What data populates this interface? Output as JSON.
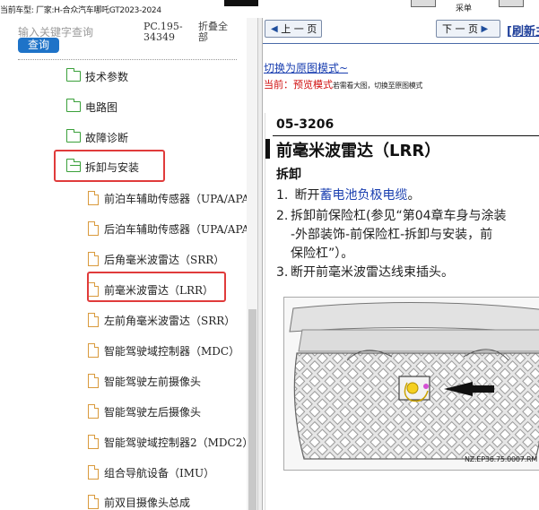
{
  "topbar": {
    "vehicle_info": "当前车型:   厂家:H-合众汽车哪吒GT2023-2024",
    "tool_left_label": "",
    "tool_right_label": "采单"
  },
  "sidebar": {
    "search_placeholder": "输入关键字查询",
    "search_button": "查询",
    "model_code": "PC.195-34349",
    "collapse_all": "折叠全部",
    "tree": [
      {
        "label": "技术参数",
        "kind": "folder",
        "open": false
      },
      {
        "label": "电路图",
        "kind": "folder",
        "open": false
      },
      {
        "label": "故障诊断",
        "kind": "folder",
        "open": false
      },
      {
        "label": "拆卸与安装",
        "kind": "folder",
        "open": true,
        "highlighted": true
      },
      {
        "label": "前泊车辅助传感器（UPA/APA）",
        "kind": "doc"
      },
      {
        "label": "后泊车辅助传感器（UPA/APA）",
        "kind": "doc"
      },
      {
        "label": "后角毫米波雷达（SRR）",
        "kind": "doc"
      },
      {
        "label": "前毫米波雷达（LRR）",
        "kind": "doc",
        "highlighted": true
      },
      {
        "label": "左前角毫米波雷达（SRR）",
        "kind": "doc"
      },
      {
        "label": "智能驾驶域控制器（MDC）",
        "kind": "doc"
      },
      {
        "label": "智能驾驶左前摄像头",
        "kind": "doc"
      },
      {
        "label": "智能驾驶左后摄像头",
        "kind": "doc"
      },
      {
        "label": "智能驾驶域控制器2（MDC2）",
        "kind": "doc"
      },
      {
        "label": "组合导航设备（IMU）",
        "kind": "doc"
      },
      {
        "label": "前双目摄像头总成",
        "kind": "doc"
      }
    ]
  },
  "viewer": {
    "prev_page": "上 一 页",
    "next_page": "下 一 页",
    "refresh": "[刷新主",
    "switch_mode": "切换为原图模式~",
    "current_label": "当前：",
    "current_mode": "预览模式",
    "current_hint": "若需看大图，切换至原图模式"
  },
  "document": {
    "section_code": "05-3206",
    "title": "前毫米波雷达（LRR）",
    "subhead": "拆卸",
    "steps": [
      {
        "num": "1.",
        "prefix": "断开",
        "link": "蓄电池负极电缆",
        "suffix": "。"
      },
      {
        "num": "2.",
        "text": "拆卸前保险杠(参见“第04章车身与涂装"
      },
      {
        "num": "",
        "text": "-外部装饰-前保险杠-拆卸与安装，前"
      },
      {
        "num": "",
        "text": "保险杠”）。"
      },
      {
        "num": "3.",
        "text": "断开前毫米波雷达线束插头。"
      }
    ],
    "figure_code": "NZ.EP36.75.0007.RM"
  }
}
